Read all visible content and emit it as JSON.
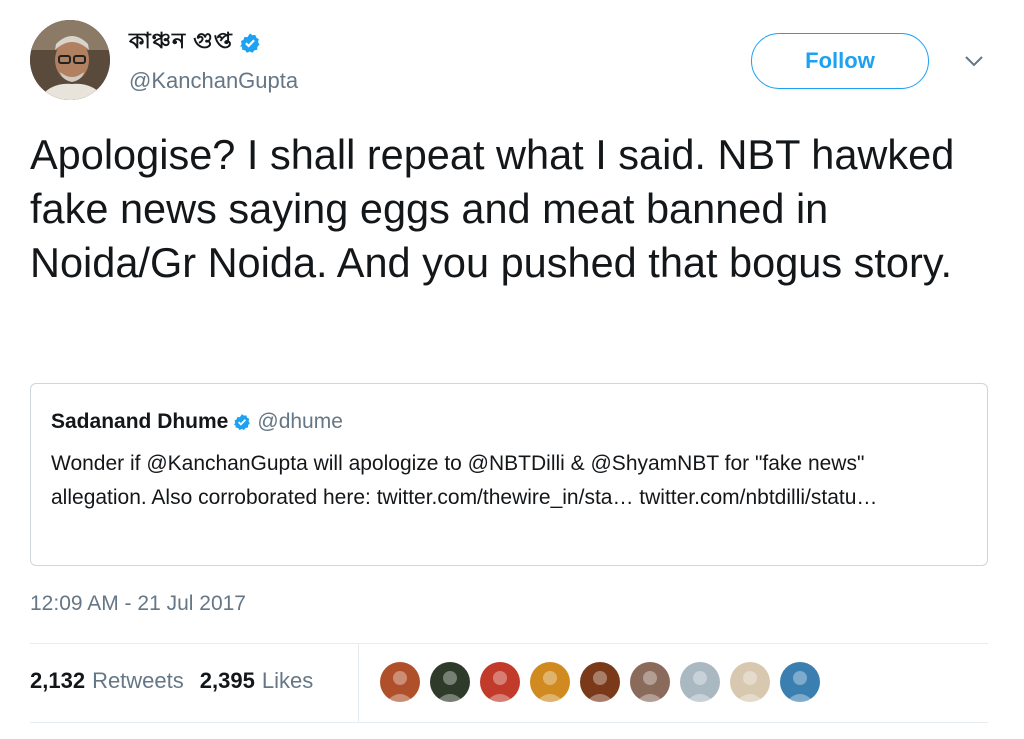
{
  "author": {
    "display_name": "কাঞ্চন গুপ্ত",
    "handle": "@KanchanGupta",
    "verified": true
  },
  "follow_label": "Follow",
  "tweet_text": "Apologise? I shall repeat what I said. NBT hawked fake news saying eggs and meat banned in Noida/Gr Noida. And you pushed that bogus story.",
  "quoted": {
    "name": "Sadanand Dhume",
    "handle": "@dhume",
    "text": "Wonder if @KanchanGupta will apologize to @NBTDilli & @ShyamNBT for \"fake news\" allegation. Also corroborated here: twitter.com/thewire_in/sta… twitter.com/nbtdilli/statu…"
  },
  "timestamp": "12:09 AM - 21 Jul 2017",
  "stats": {
    "retweets_count": "2,132",
    "retweets_label": "Retweets",
    "likes_count": "2,395",
    "likes_label": "Likes"
  },
  "liker_avatars": [
    "#b0502a",
    "#2f3b2a",
    "#c23a2a",
    "#d08a20",
    "#7a3a1a",
    "#8a6a5a",
    "#aab8c2",
    "#d8c8b0",
    "#3a7fb0"
  ],
  "colors": {
    "accent": "#1da1f2",
    "secondary_text": "#657786",
    "border": "#ccd6dd"
  }
}
